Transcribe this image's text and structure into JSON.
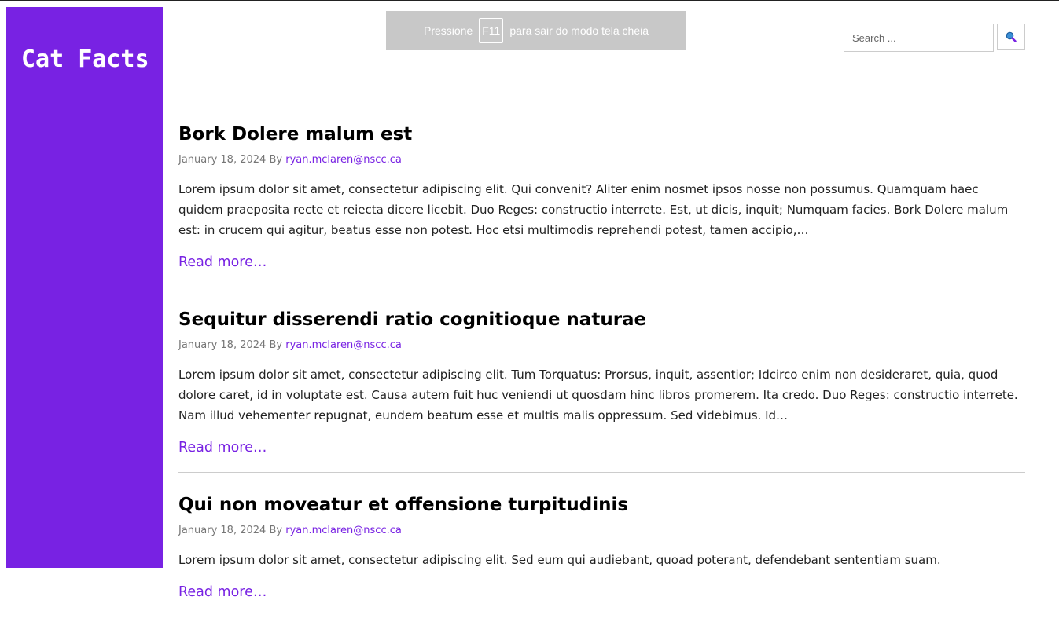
{
  "site": {
    "title": "Cat Facts",
    "accent_color": "#7822e3"
  },
  "fullscreen_banner": {
    "prefix": "Pressione",
    "key": "F11",
    "suffix": "para sair do modo tela cheia"
  },
  "search": {
    "placeholder": "Search ...",
    "value": "",
    "button_icon": "search-icon"
  },
  "posts": [
    {
      "title": "Bork Dolere malum est",
      "date": "January 18, 2024",
      "by": "By",
      "author": "ryan.mclaren@nscc.ca",
      "excerpt": "Lorem ipsum dolor sit amet, consectetur adipiscing elit. Qui convenit? Aliter enim nosmet ipsos nosse non possumus. Quamquam haec quidem praeposita recte et reiecta dicere licebit. Duo Reges: constructio interrete. Est, ut dicis, inquit; Numquam facies. Bork Dolere malum est: in crucem qui agitur, beatus esse non potest. Hoc etsi multimodis reprehendi potest, tamen accipio,…",
      "read_more": "Read more…"
    },
    {
      "title": "Sequitur disserendi ratio cognitioque naturae",
      "date": "January 18, 2024",
      "by": "By",
      "author": "ryan.mclaren@nscc.ca",
      "excerpt": "Lorem ipsum dolor sit amet, consectetur adipiscing elit. Tum Torquatus: Prorsus, inquit, assentior; Idcirco enim non desideraret, quia, quod dolore caret, id in voluptate est. Causa autem fuit huc veniendi ut quosdam hinc libros promerem. Ita credo. Duo Reges: constructio interrete. Nam illud vehementer repugnat, eundem beatum esse et multis malis oppressum. Sed videbimus. Id…",
      "read_more": "Read more…"
    },
    {
      "title": "Qui non moveatur et offensione turpitudinis",
      "date": "January 18, 2024",
      "by": "By",
      "author": "ryan.mclaren@nscc.ca",
      "excerpt": "Lorem ipsum dolor sit amet, consectetur adipiscing elit. Sed eum qui audiebant, quoad poterant, defendebant sententiam suam.",
      "read_more": "Read more…"
    }
  ]
}
